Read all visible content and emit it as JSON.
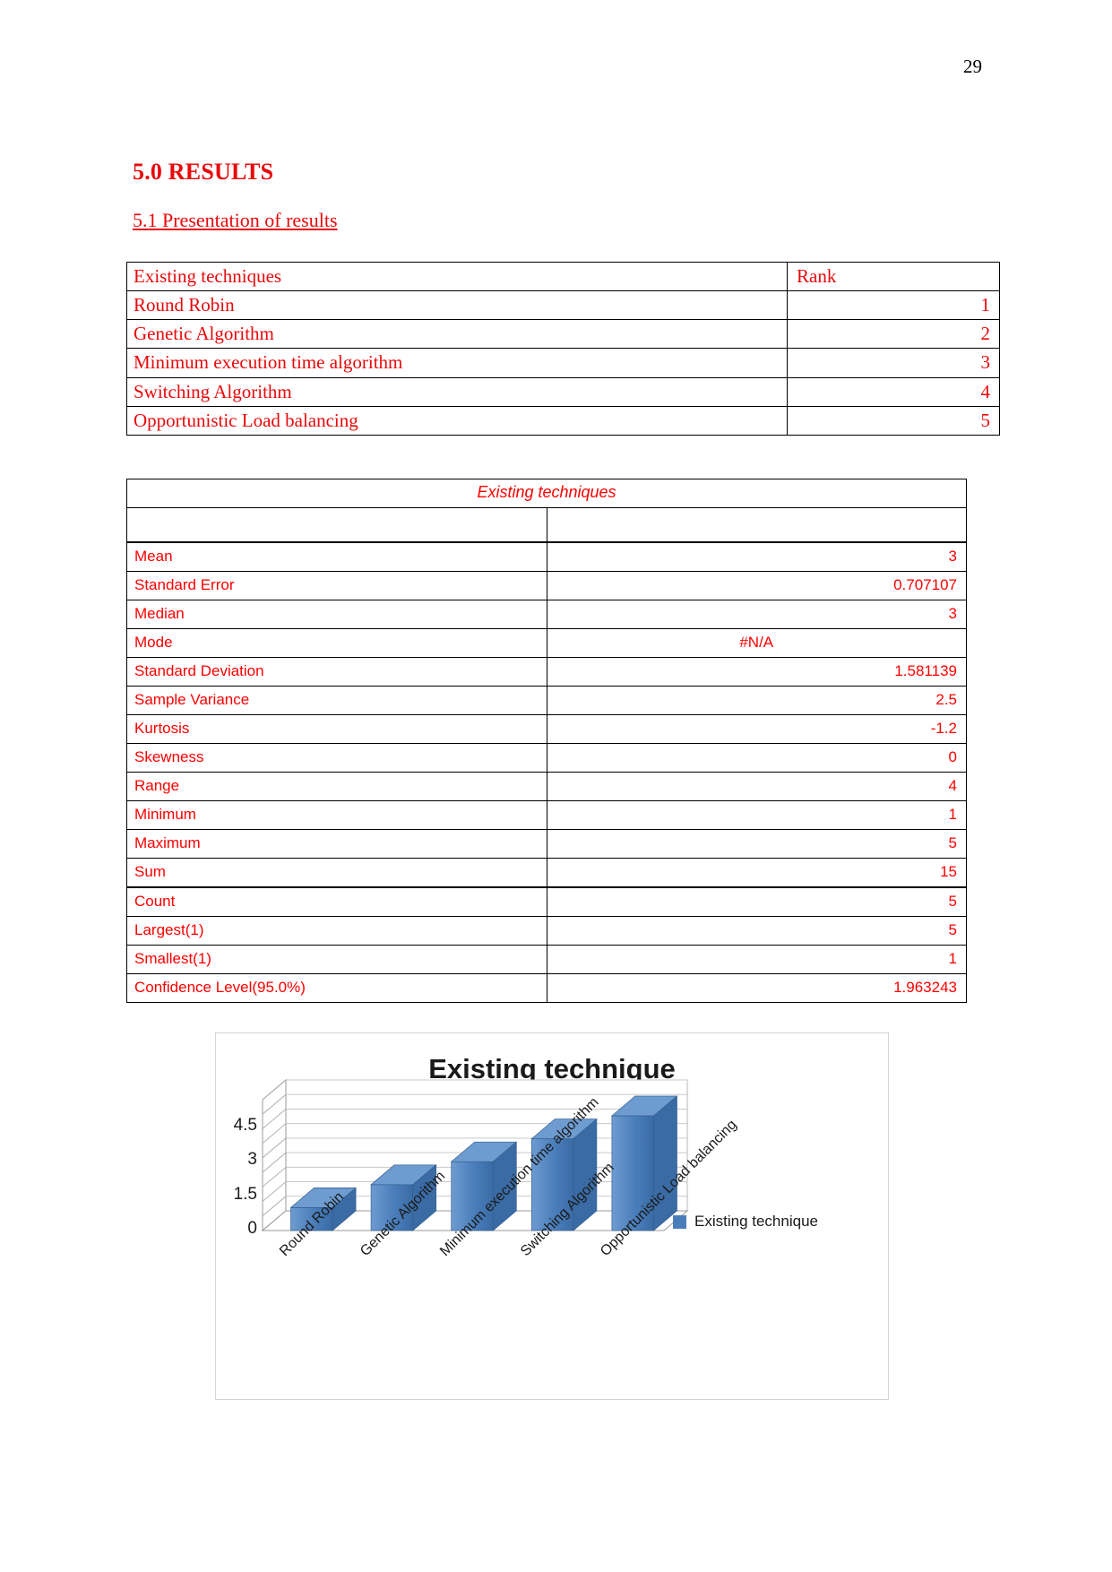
{
  "page": {
    "number": "29"
  },
  "headings": {
    "results": "5.0 RESULTS",
    "presentation": "5.1 Presentation of results"
  },
  "rank_table": {
    "header": {
      "technique": "Existing techniques",
      "rank": "Rank"
    },
    "rows": [
      {
        "technique": "Round Robin",
        "rank": "1"
      },
      {
        "technique": "Genetic Algorithm",
        "rank": "2"
      },
      {
        "technique": "Minimum execution time algorithm",
        "rank": "3"
      },
      {
        "technique": "Switching Algorithm",
        "rank": "4"
      },
      {
        "technique": "Opportunistic Load balancing",
        "rank": "5"
      }
    ]
  },
  "stats_table": {
    "title": "Existing techniques",
    "rows": [
      {
        "label": "Mean",
        "value": "3",
        "align": "right"
      },
      {
        "label": "Standard Error",
        "value": "0.707107",
        "align": "right"
      },
      {
        "label": "Median",
        "value": "3",
        "align": "right"
      },
      {
        "label": "Mode",
        "value": "#N/A",
        "align": "center"
      },
      {
        "label": "Standard Deviation",
        "value": "1.581139",
        "align": "right"
      },
      {
        "label": "Sample Variance",
        "value": "2.5",
        "align": "right"
      },
      {
        "label": "Kurtosis",
        "value": "-1.2",
        "align": "right"
      },
      {
        "label": "Skewness",
        "value": "0",
        "align": "right"
      },
      {
        "label": "Range",
        "value": "4",
        "align": "right"
      },
      {
        "label": "Minimum",
        "value": "1",
        "align": "right"
      },
      {
        "label": "Maximum",
        "value": "5",
        "align": "right"
      },
      {
        "label": "Sum",
        "value": "15",
        "align": "right"
      },
      {
        "label": "Count",
        "value": "5",
        "align": "right"
      },
      {
        "label": "Largest(1)",
        "value": "5",
        "align": "right"
      },
      {
        "label": "Smallest(1)",
        "value": "1",
        "align": "right"
      },
      {
        "label": "Confidence Level(95.0%)",
        "value": "1.963243",
        "align": "right"
      }
    ]
  },
  "chart_data": {
    "type": "bar",
    "title": "Existing technique",
    "xlabel": "",
    "ylabel": "",
    "ylim": [
      0,
      5
    ],
    "grid": true,
    "legend_position": "right",
    "series": [
      {
        "name": "Existing technique",
        "color": "#4a7ebb",
        "values": [
          1,
          2,
          3,
          4,
          5
        ]
      }
    ],
    "categories": [
      "Round Robin",
      "Genetic Algorithm",
      "Minimum execution time algorithm",
      "Switching Algorithm",
      "Opportunistic Load balancing"
    ],
    "yticks": [
      "0",
      "1.5",
      "3",
      "4.5"
    ],
    "ytick_values": [
      0,
      1.5,
      3,
      4.5
    ]
  },
  "colors": {
    "heading_red": "#e8090b",
    "table_red": "#fe0000",
    "bar_blue": "#4a7ebb",
    "bar_blue_dark": "#3a6ba5",
    "bar_blue_light": "#6e9bd0"
  }
}
